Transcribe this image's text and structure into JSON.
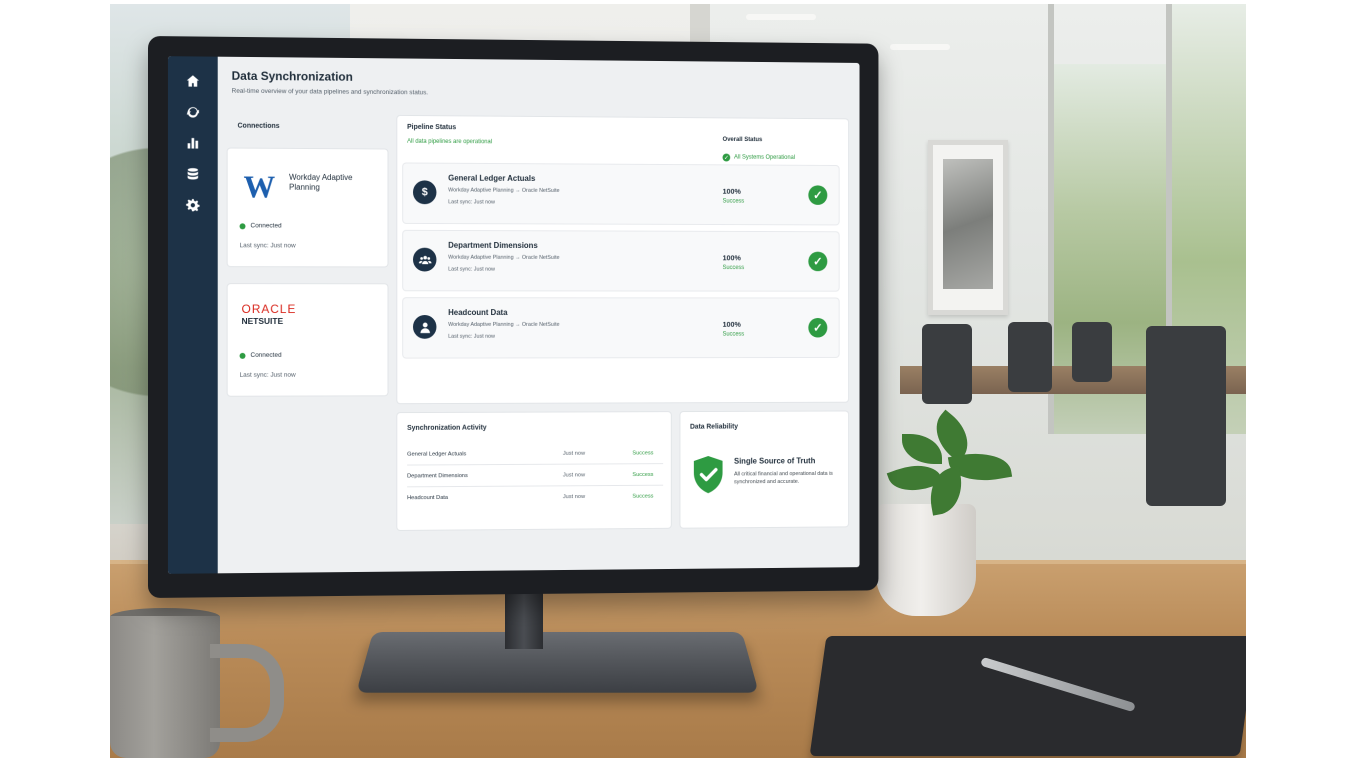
{
  "page": {
    "title": "Data Synchronization",
    "subtitle": "Real-time overview of your data pipelines and synchronization status."
  },
  "sidebar": {
    "icons": [
      "home-icon",
      "sync-icon",
      "chart-icon",
      "database-icon",
      "gear-icon"
    ]
  },
  "connections": {
    "title": "Connections",
    "items": [
      {
        "logo": "W",
        "name": "Workday Adaptive Planning",
        "status": "Connected",
        "last_sync": "Last sync: Just now"
      },
      {
        "logo_top": "ORACLE",
        "logo_bottom": "NETSUITE",
        "status": "Connected",
        "last_sync": "Last sync: Just now"
      }
    ]
  },
  "pipeline": {
    "title": "Pipeline Status",
    "status_text": "All data pipelines are operational",
    "overall_label": "Overall Status",
    "overall_value": "All Systems Operational",
    "rows": [
      {
        "icon": "dollar-icon",
        "name": "General Ledger Actuals",
        "route": "Workday Adaptive Planning → Oracle NetSuite",
        "last_sync": "Last sync: Just now",
        "percent": "100%",
        "state": "Success"
      },
      {
        "icon": "team-icon",
        "name": "Department Dimensions",
        "route": "Workday Adaptive Planning → Oracle NetSuite",
        "last_sync": "Last sync: Just now",
        "percent": "100%",
        "state": "Success"
      },
      {
        "icon": "user-icon",
        "name": "Headcount Data",
        "route": "Workday Adaptive Planning → Oracle NetSuite",
        "last_sync": "Last sync: Just now",
        "percent": "100%",
        "state": "Success"
      }
    ]
  },
  "activity": {
    "title": "Synchronization Activity",
    "rows": [
      {
        "name": "General Ledger Actuals",
        "time": "Just now",
        "state": "Success"
      },
      {
        "name": "Department Dimensions",
        "time": "Just now",
        "state": "Success"
      },
      {
        "name": "Headcount Data",
        "time": "Just now",
        "state": "Success"
      }
    ]
  },
  "reliability": {
    "title": "Data Reliability",
    "heading": "Single Source of Truth",
    "text": "All critical financial and operational data is synchronized and accurate."
  },
  "colors": {
    "sidebar": "#1d3247",
    "success": "#2e9b42",
    "workday_blue": "#1d5fae",
    "oracle_red": "#d9281e"
  }
}
